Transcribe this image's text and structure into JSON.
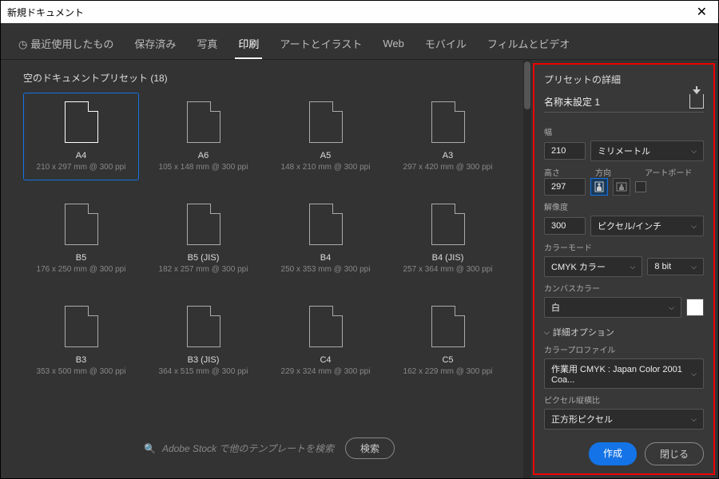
{
  "window": {
    "title": "新規ドキュメント"
  },
  "tabs": {
    "recent": "最近使用したもの",
    "saved": "保存済み",
    "photo": "写真",
    "print": "印刷",
    "art": "アートとイラスト",
    "web": "Web",
    "mobile": "モバイル",
    "film": "フィルムとビデオ",
    "active": "print"
  },
  "presets_header": "空のドキュメントプリセット  (18)",
  "presets": [
    {
      "name": "A4",
      "dim": "210 x 297 mm @ 300 ppi",
      "selected": true
    },
    {
      "name": "A6",
      "dim": "105 x 148 mm @ 300 ppi"
    },
    {
      "name": "A5",
      "dim": "148 x 210 mm @ 300 ppi"
    },
    {
      "name": "A3",
      "dim": "297 x 420 mm @ 300 ppi"
    },
    {
      "name": "B5",
      "dim": "176 x 250 mm @ 300 ppi"
    },
    {
      "name": "B5 (JIS)",
      "dim": "182 x 257 mm @ 300 ppi"
    },
    {
      "name": "B4",
      "dim": "250 x 353 mm @ 300 ppi"
    },
    {
      "name": "B4 (JIS)",
      "dim": "257 x 364 mm @ 300 ppi"
    },
    {
      "name": "B3",
      "dim": "353 x 500 mm @ 300 ppi"
    },
    {
      "name": "B3 (JIS)",
      "dim": "364 x 515 mm @ 300 ppi"
    },
    {
      "name": "C4",
      "dim": "229 x 324 mm @ 300 ppi"
    },
    {
      "name": "C5",
      "dim": "162 x 229 mm @ 300 ppi"
    }
  ],
  "stock": {
    "placeholder": "Adobe Stock で他のテンプレートを検索",
    "search_btn": "検索"
  },
  "details": {
    "title": "プリセットの詳細",
    "name": "名称未設定 1",
    "width_label": "幅",
    "width_value": "210",
    "unit": "ミリメートル",
    "height_label": "高さ",
    "height_value": "297",
    "orient_label": "方向",
    "artboard_label": "アートボード",
    "res_label": "解像度",
    "res_value": "300",
    "res_unit": "ピクセル/インチ",
    "mode_label": "カラーモード",
    "mode_value": "CMYK カラー",
    "bit_value": "8 bit",
    "bg_label": "カンバスカラー",
    "bg_value": "白",
    "adv_label": "詳細オプション",
    "profile_label": "カラープロファイル",
    "profile_value": "作業用 CMYK : Japan Color 2001 Coa...",
    "aspect_label": "ピクセル縦横比",
    "aspect_value": "正方形ピクセル",
    "create_btn": "作成",
    "close_btn": "閉じる"
  }
}
